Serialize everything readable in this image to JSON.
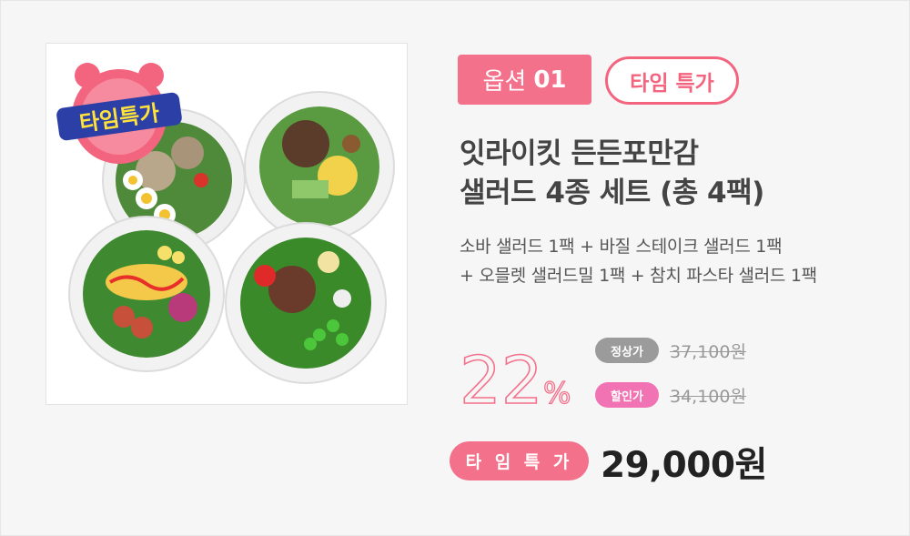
{
  "option_badge": {
    "prefix": "옵션",
    "number": "01"
  },
  "time_sale_badge": "타임 특가",
  "product_image": {
    "sticker_text": "타임특가"
  },
  "title": {
    "line1": "잇라이킷 든든포만감",
    "line2": "샐러드 4종 세트 (총 4팩)"
  },
  "description": {
    "line1": "소바 샐러드 1팩 + 바질 스테이크 샐러드 1팩",
    "line2": "+ 오믈렛 샐러드밀 1팩 + 참치 파스타 샐러드 1팩"
  },
  "discount": {
    "value": "22",
    "unit": "%"
  },
  "regular_price": {
    "label": "정상가",
    "value": "37,100원"
  },
  "discount_price": {
    "label": "할인가",
    "value": "34,100원"
  },
  "time_sale_label": "타 임 특 가",
  "final_price": "29,000원",
  "colors": {
    "accent": "#f4718b",
    "pink_label": "#f273b4",
    "gray_label": "#9b9b9b"
  }
}
